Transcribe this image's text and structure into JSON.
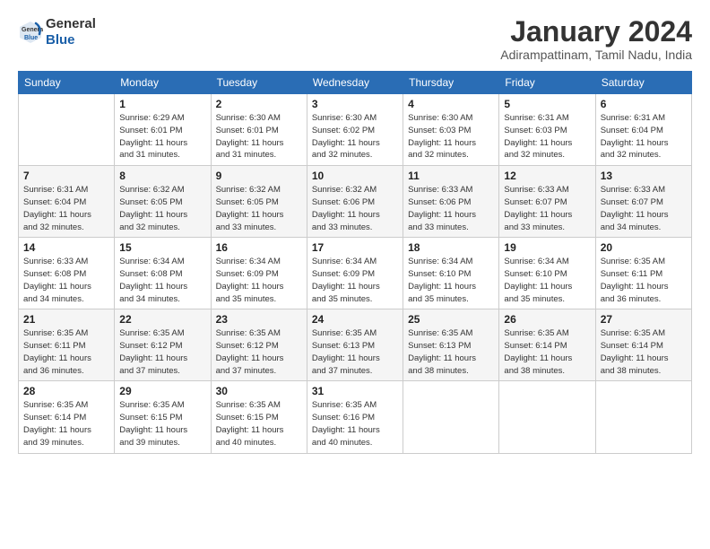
{
  "header": {
    "logo_line1": "General",
    "logo_line2": "Blue",
    "month_title": "January 2024",
    "location": "Adirampattinam, Tamil Nadu, India"
  },
  "calendar": {
    "days_of_week": [
      "Sunday",
      "Monday",
      "Tuesday",
      "Wednesday",
      "Thursday",
      "Friday",
      "Saturday"
    ],
    "weeks": [
      [
        {
          "day": "",
          "info": ""
        },
        {
          "day": "1",
          "info": "Sunrise: 6:29 AM\nSunset: 6:01 PM\nDaylight: 11 hours\nand 31 minutes."
        },
        {
          "day": "2",
          "info": "Sunrise: 6:30 AM\nSunset: 6:01 PM\nDaylight: 11 hours\nand 31 minutes."
        },
        {
          "day": "3",
          "info": "Sunrise: 6:30 AM\nSunset: 6:02 PM\nDaylight: 11 hours\nand 32 minutes."
        },
        {
          "day": "4",
          "info": "Sunrise: 6:30 AM\nSunset: 6:03 PM\nDaylight: 11 hours\nand 32 minutes."
        },
        {
          "day": "5",
          "info": "Sunrise: 6:31 AM\nSunset: 6:03 PM\nDaylight: 11 hours\nand 32 minutes."
        },
        {
          "day": "6",
          "info": "Sunrise: 6:31 AM\nSunset: 6:04 PM\nDaylight: 11 hours\nand 32 minutes."
        }
      ],
      [
        {
          "day": "7",
          "info": "Sunrise: 6:31 AM\nSunset: 6:04 PM\nDaylight: 11 hours\nand 32 minutes."
        },
        {
          "day": "8",
          "info": "Sunrise: 6:32 AM\nSunset: 6:05 PM\nDaylight: 11 hours\nand 32 minutes."
        },
        {
          "day": "9",
          "info": "Sunrise: 6:32 AM\nSunset: 6:05 PM\nDaylight: 11 hours\nand 33 minutes."
        },
        {
          "day": "10",
          "info": "Sunrise: 6:32 AM\nSunset: 6:06 PM\nDaylight: 11 hours\nand 33 minutes."
        },
        {
          "day": "11",
          "info": "Sunrise: 6:33 AM\nSunset: 6:06 PM\nDaylight: 11 hours\nand 33 minutes."
        },
        {
          "day": "12",
          "info": "Sunrise: 6:33 AM\nSunset: 6:07 PM\nDaylight: 11 hours\nand 33 minutes."
        },
        {
          "day": "13",
          "info": "Sunrise: 6:33 AM\nSunset: 6:07 PM\nDaylight: 11 hours\nand 34 minutes."
        }
      ],
      [
        {
          "day": "14",
          "info": "Sunrise: 6:33 AM\nSunset: 6:08 PM\nDaylight: 11 hours\nand 34 minutes."
        },
        {
          "day": "15",
          "info": "Sunrise: 6:34 AM\nSunset: 6:08 PM\nDaylight: 11 hours\nand 34 minutes."
        },
        {
          "day": "16",
          "info": "Sunrise: 6:34 AM\nSunset: 6:09 PM\nDaylight: 11 hours\nand 35 minutes."
        },
        {
          "day": "17",
          "info": "Sunrise: 6:34 AM\nSunset: 6:09 PM\nDaylight: 11 hours\nand 35 minutes."
        },
        {
          "day": "18",
          "info": "Sunrise: 6:34 AM\nSunset: 6:10 PM\nDaylight: 11 hours\nand 35 minutes."
        },
        {
          "day": "19",
          "info": "Sunrise: 6:34 AM\nSunset: 6:10 PM\nDaylight: 11 hours\nand 35 minutes."
        },
        {
          "day": "20",
          "info": "Sunrise: 6:35 AM\nSunset: 6:11 PM\nDaylight: 11 hours\nand 36 minutes."
        }
      ],
      [
        {
          "day": "21",
          "info": "Sunrise: 6:35 AM\nSunset: 6:11 PM\nDaylight: 11 hours\nand 36 minutes."
        },
        {
          "day": "22",
          "info": "Sunrise: 6:35 AM\nSunset: 6:12 PM\nDaylight: 11 hours\nand 37 minutes."
        },
        {
          "day": "23",
          "info": "Sunrise: 6:35 AM\nSunset: 6:12 PM\nDaylight: 11 hours\nand 37 minutes."
        },
        {
          "day": "24",
          "info": "Sunrise: 6:35 AM\nSunset: 6:13 PM\nDaylight: 11 hours\nand 37 minutes."
        },
        {
          "day": "25",
          "info": "Sunrise: 6:35 AM\nSunset: 6:13 PM\nDaylight: 11 hours\nand 38 minutes."
        },
        {
          "day": "26",
          "info": "Sunrise: 6:35 AM\nSunset: 6:14 PM\nDaylight: 11 hours\nand 38 minutes."
        },
        {
          "day": "27",
          "info": "Sunrise: 6:35 AM\nSunset: 6:14 PM\nDaylight: 11 hours\nand 38 minutes."
        }
      ],
      [
        {
          "day": "28",
          "info": "Sunrise: 6:35 AM\nSunset: 6:14 PM\nDaylight: 11 hours\nand 39 minutes."
        },
        {
          "day": "29",
          "info": "Sunrise: 6:35 AM\nSunset: 6:15 PM\nDaylight: 11 hours\nand 39 minutes."
        },
        {
          "day": "30",
          "info": "Sunrise: 6:35 AM\nSunset: 6:15 PM\nDaylight: 11 hours\nand 40 minutes."
        },
        {
          "day": "31",
          "info": "Sunrise: 6:35 AM\nSunset: 6:16 PM\nDaylight: 11 hours\nand 40 minutes."
        },
        {
          "day": "",
          "info": ""
        },
        {
          "day": "",
          "info": ""
        },
        {
          "day": "",
          "info": ""
        }
      ]
    ]
  }
}
